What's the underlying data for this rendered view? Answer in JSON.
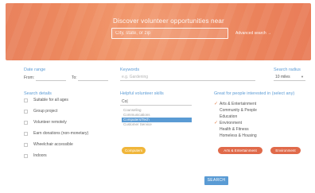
{
  "hero": {
    "title": "Discover volunteer opportunities near",
    "search_placeholder": "City, state, or zip",
    "advanced_link": "Advanced search →"
  },
  "filters": {
    "date_range_label": "Date range",
    "from_label": "From:",
    "to_label": "To:",
    "keywords_label": "Keywords",
    "keywords_placeholder": "e.g. Gardening",
    "search_radius_label": "Search radius",
    "search_radius_value": "10 miles"
  },
  "search_details": {
    "label": "Search details",
    "options": [
      "Suitable for all ages",
      "Group project",
      "Volunteer remotely",
      "Earn donations (non-monetary)",
      "Wheelchair accessible",
      "Indoors"
    ]
  },
  "helpful_skills": {
    "label": "Helpful volunteer skills",
    "input_value": "Co|",
    "items": [
      "Counseling",
      "Communications",
      "Computers/Tech",
      "Customer Service"
    ],
    "active_index": 2,
    "pill_label": "Computers"
  },
  "causes": {
    "label": "Great for people interested in (select any)",
    "items": [
      {
        "label": "Arts & Entertainment",
        "checked": true
      },
      {
        "label": "Community & People",
        "checked": false
      },
      {
        "label": "Education",
        "checked": false
      },
      {
        "label": "Environment",
        "checked": true
      },
      {
        "label": "Health & Fitness",
        "checked": false
      },
      {
        "label": "Homeless & Housing",
        "checked": false
      }
    ],
    "selected_tags": [
      "Arts & Entertainment",
      "Environment"
    ]
  },
  "search_button": "SEARCH",
  "colors": {
    "accent_blue": "#5a9bd4",
    "accent_orange": "#e3834f",
    "hero_orange": "#ef8b5f",
    "pill_yellow": "#f0b63a"
  }
}
